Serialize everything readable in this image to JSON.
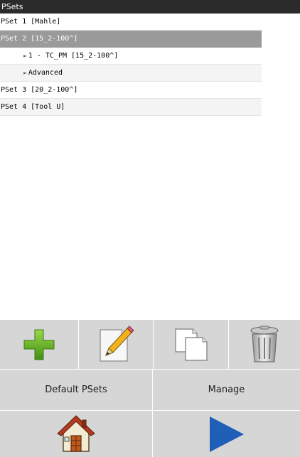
{
  "window": {
    "title": "PSets"
  },
  "tree": [
    {
      "label": "PSet 1 [Mahle]",
      "level": 0,
      "expanded": false
    },
    {
      "label": "PSet 2 [15_2-100^]",
      "level": 0,
      "selected": true
    },
    {
      "label": "1 - TC_PM [15_2-100^]",
      "level": 1,
      "arrow": "►"
    },
    {
      "label": "Advanced",
      "level": 1,
      "arrow": "►"
    },
    {
      "label": "PSet 3 [20_2-100^]",
      "level": 0
    },
    {
      "label": "PSet 4 [Tool U]",
      "level": 0
    }
  ],
  "toolbar": {
    "items": [
      {
        "icon": "plus-icon"
      },
      {
        "icon": "pencil-edit-icon"
      },
      {
        "icon": "copy-pages-icon"
      },
      {
        "icon": "trash-bin-icon"
      }
    ]
  },
  "actions": {
    "default_psets_label": "Default PSets",
    "manage_label": "Manage"
  },
  "nav": {
    "home_icon": "home-icon",
    "play_icon": "play-icon"
  },
  "colors": {
    "titlebar": "#2b2b2b",
    "selected_row": "#9a9a9a",
    "toolbar_bg": "#d6d6d6",
    "plus_green": "#5aa61c",
    "play_blue": "#1f5fb7"
  }
}
